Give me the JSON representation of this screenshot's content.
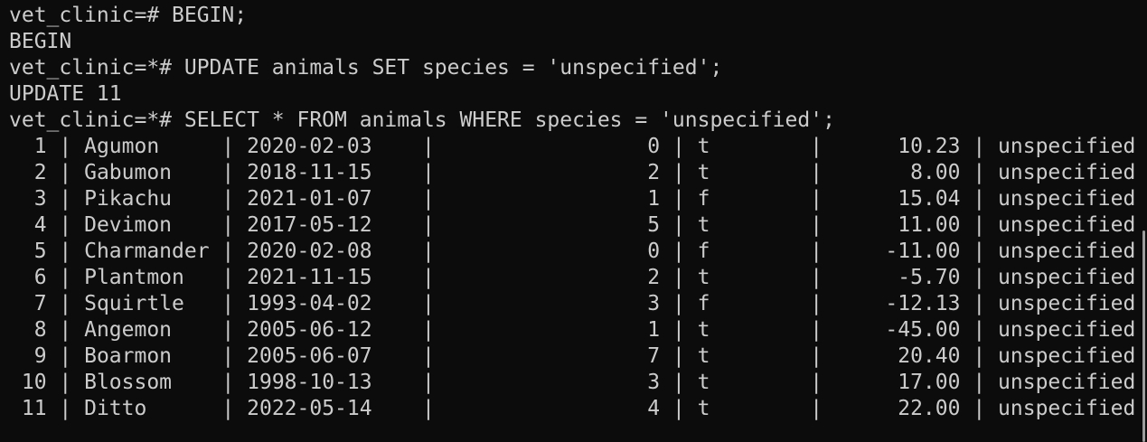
{
  "terminal": {
    "lines": [
      {
        "prompt": "vet_clinic=#",
        "command": " BEGIN;"
      },
      {
        "output": "BEGIN"
      },
      {
        "prompt": "vet_clinic=*#",
        "command": " UPDATE animals SET species = 'unspecified';"
      },
      {
        "output": "UPDATE 11"
      },
      {
        "prompt": "vet_clinic=*#",
        "command": " SELECT * FROM animals WHERE species = 'unspecified';"
      }
    ],
    "rows": [
      [
        "  1 | ",
        "Agumon    ",
        " | ",
        "2020-02-03",
        "    |                 ",
        "0",
        " | ",
        "t",
        "        |     ",
        " 10.23",
        " | ",
        "unspecified"
      ],
      [
        "  2 | ",
        "Gabumon   ",
        " | ",
        "2018-11-15",
        "    |                 ",
        "2",
        " | ",
        "t",
        "        |     ",
        "  8.00",
        " | ",
        "unspecified"
      ],
      [
        "  3 | ",
        "Pikachu   ",
        " | ",
        "2021-01-07",
        "    |                 ",
        "1",
        " | ",
        "f",
        "        |     ",
        " 15.04",
        " | ",
        "unspecified"
      ],
      [
        "  4 | ",
        "Devimon   ",
        " | ",
        "2017-05-12",
        "    |                 ",
        "5",
        " | ",
        "t",
        "        |     ",
        " 11.00",
        " | ",
        "unspecified"
      ],
      [
        "  5 | ",
        "Charmander",
        " | ",
        "2020-02-08",
        "    |                 ",
        "0",
        " | ",
        "f",
        "        |     ",
        "-11.00",
        " | ",
        "unspecified"
      ],
      [
        "  6 | ",
        "Plantmon  ",
        " | ",
        "2021-11-15",
        "    |                 ",
        "2",
        " | ",
        "t",
        "        |     ",
        " -5.70",
        " | ",
        "unspecified"
      ],
      [
        "  7 | ",
        "Squirtle  ",
        " | ",
        "1993-04-02",
        "    |                 ",
        "3",
        " | ",
        "f",
        "        |     ",
        "-12.13",
        " | ",
        "unspecified"
      ],
      [
        "  8 | ",
        "Angemon   ",
        " | ",
        "2005-06-12",
        "    |                 ",
        "1",
        " | ",
        "t",
        "        |     ",
        "-45.00",
        " | ",
        "unspecified"
      ],
      [
        "  9 | ",
        "Boarmon   ",
        " | ",
        "2005-06-07",
        "    |                 ",
        "7",
        " | ",
        "t",
        "        |     ",
        " 20.40",
        " | ",
        "unspecified"
      ],
      [
        " 10 | ",
        "Blossom   ",
        " | ",
        "1998-10-13",
        "    |                 ",
        "3",
        " | ",
        "t",
        "        |     ",
        " 17.00",
        " | ",
        "unspecified"
      ],
      [
        " 11 | ",
        "Ditto     ",
        " | ",
        "2022-05-14",
        "    |                 ",
        "4",
        " | ",
        "t",
        "        |     ",
        " 22.00",
        " | ",
        "unspecified"
      ]
    ],
    "colors": {
      "background": "#0c0c0c",
      "foreground": "#cccccc",
      "scrollbar": "#9d9d9d"
    }
  }
}
